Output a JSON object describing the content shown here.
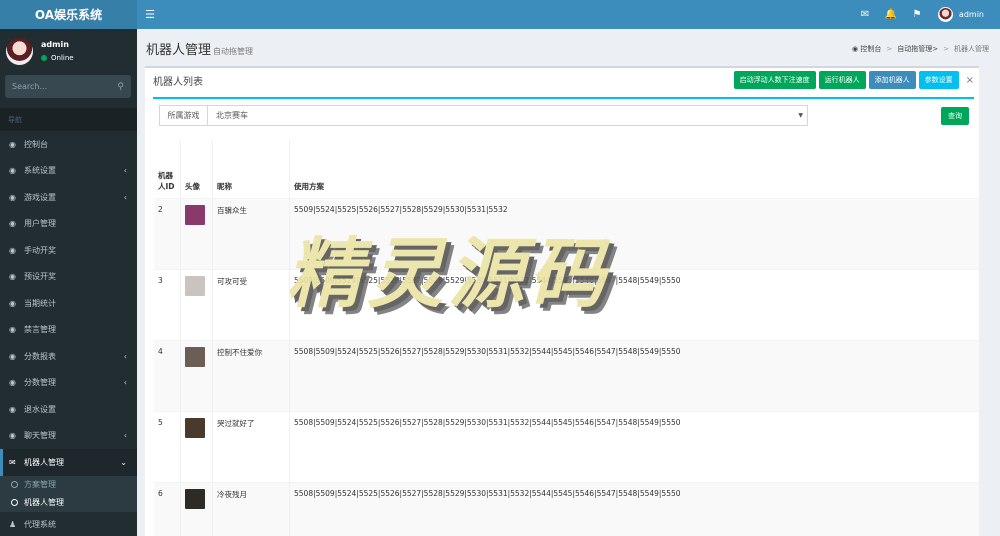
{
  "app": {
    "logo": "OA娱乐系统"
  },
  "topbar": {
    "user_name": "admin",
    "icons": [
      "mail-icon",
      "bell-icon",
      "flag-icon"
    ]
  },
  "sidebar": {
    "user": {
      "name": "admin",
      "status": "Online"
    },
    "search_placeholder": "Search...",
    "nav_header": "导航",
    "items": [
      {
        "label": "控制台",
        "icon": "dashboard-icon",
        "caret": ""
      },
      {
        "label": "系统设置",
        "icon": "cogs-icon",
        "caret": "‹"
      },
      {
        "label": "游戏设置",
        "icon": "gamepad-icon",
        "caret": "‹"
      },
      {
        "label": "用户管理",
        "icon": "users-icon",
        "caret": ""
      },
      {
        "label": "手动开奖",
        "icon": "handshake-icon",
        "caret": ""
      },
      {
        "label": "预设开奖",
        "icon": "gear-icon",
        "caret": ""
      },
      {
        "label": "当期统计",
        "icon": "calendar-icon",
        "caret": ""
      },
      {
        "label": "禁言管理",
        "icon": "warning-icon",
        "caret": ""
      },
      {
        "label": "分数报表",
        "icon": "list-icon",
        "caret": "‹"
      },
      {
        "label": "分数管理",
        "icon": "list-icon",
        "caret": "‹"
      },
      {
        "label": "退水设置",
        "icon": "refresh-icon",
        "caret": ""
      },
      {
        "label": "聊天管理",
        "icon": "chat-icon",
        "caret": "‹"
      }
    ],
    "active_item": {
      "label": "机器人管理",
      "icon": "comment-icon",
      "caret": "⌄"
    },
    "sub_items": [
      {
        "label": "方案管理"
      },
      {
        "label": "机器人管理"
      }
    ],
    "last_item": {
      "label": "代理系统",
      "icon": "users-icon"
    }
  },
  "page": {
    "title": "机器人管理",
    "subtitle": "自动拖管理",
    "breadcrumb": [
      "控制台",
      "自动拖管理>",
      "机器人管理"
    ]
  },
  "box": {
    "title": "机器人列表",
    "buttons": [
      {
        "label": "启动浮动人数下注速度",
        "color": "#00a65a"
      },
      {
        "label": "运行机器人",
        "color": "#00a65a"
      },
      {
        "label": "添加机器人",
        "color": "#3c8dbc"
      },
      {
        "label": "参数设置",
        "color": "#00c0ef"
      }
    ],
    "close": "×"
  },
  "filter": {
    "label": "所属游戏",
    "selected": "北京赛车",
    "query_button": "查询"
  },
  "table": {
    "headers": {
      "id": "机器\n人ID",
      "avatar": "头像",
      "nickname": "昵称",
      "plan": "使用方案"
    },
    "rows": [
      {
        "id": "2",
        "nickname": "百骥众生",
        "plan": "5509|5524|5525|5526|5527|5528|5529|5530|5531|5532",
        "avatar_color": "#8a3a6a"
      },
      {
        "id": "3",
        "nickname": "可攻可受",
        "plan": "5508|5509|5524|5525|5526|5527|5528|5529|5530|5531|5532|5544|5545|5546|5547|5548|5549|5550",
        "avatar_color": "#c9c4c0"
      },
      {
        "id": "4",
        "nickname": "控制不住爱你",
        "plan": "5508|5509|5524|5525|5526|5527|5528|5529|5530|5531|5532|5544|5545|5546|5547|5548|5549|5550",
        "avatar_color": "#6b5e55"
      },
      {
        "id": "5",
        "nickname": "哭过就好了",
        "plan": "5508|5509|5524|5525|5526|5527|5528|5529|5530|5531|5532|5544|5545|5546|5547|5548|5549|5550",
        "avatar_color": "#4a3a2c"
      },
      {
        "id": "6",
        "nickname": "冷夜残月",
        "plan": "5508|5509|5524|5525|5526|5527|5528|5529|5530|5531|5532|5544|5545|5546|5547|5548|5549|5550",
        "avatar_color": "#2e2a26"
      }
    ]
  },
  "watermark": "精灵源码"
}
